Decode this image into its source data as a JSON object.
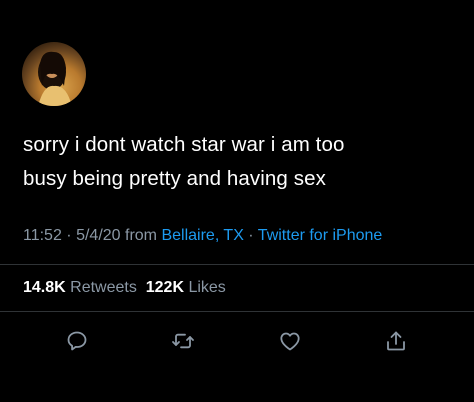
{
  "tweet": {
    "text_line1": "sorry i dont watch star war i am too",
    "text_line2": "busy being pretty and having sex",
    "time": "11:52",
    "separator1": " · ",
    "date": "5/4/20",
    "from_label": " from ",
    "location": "Bellaire, TX",
    "separator2": " · ",
    "source": "Twitter for iPhone"
  },
  "stats": {
    "retweets_count": "14.8K",
    "retweets_label": "Retweets",
    "likes_count": "122K",
    "likes_label": "Likes"
  },
  "actions": {
    "icons": [
      "reply-icon",
      "retweet-icon",
      "like-icon",
      "share-icon"
    ]
  },
  "colors": {
    "background": "#000000",
    "text": "#ffffff",
    "secondary": "#8b98a5",
    "link": "#1d9bf0",
    "divider": "#2f3336"
  }
}
